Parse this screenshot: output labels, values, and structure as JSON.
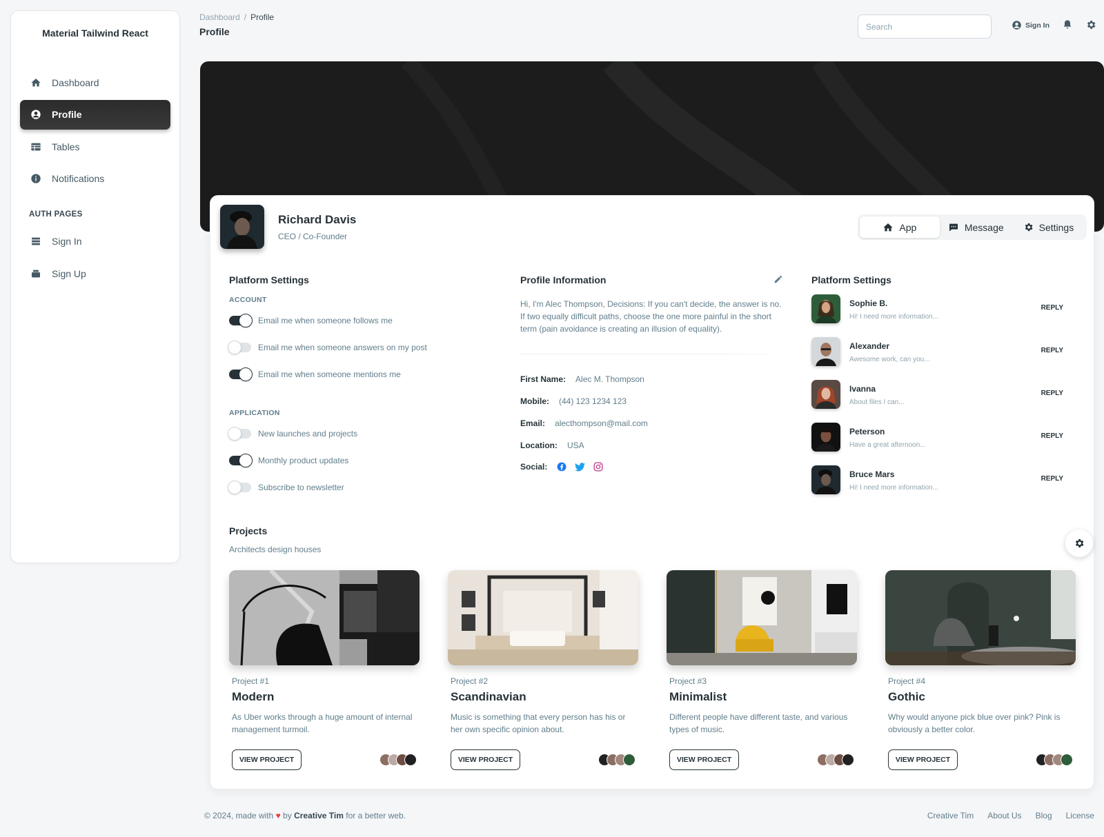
{
  "brand": "Material Tailwind React",
  "sidebar": {
    "items": [
      {
        "label": "Dashboard",
        "icon": "home-icon"
      },
      {
        "label": "Profile",
        "icon": "user-circle-icon",
        "active": true
      },
      {
        "label": "Tables",
        "icon": "table-icon"
      },
      {
        "label": "Notifications",
        "icon": "info-icon"
      }
    ],
    "auth_label": "AUTH PAGES",
    "auth_items": [
      {
        "label": "Sign In",
        "icon": "sign-in-icon"
      },
      {
        "label": "Sign Up",
        "icon": "sign-up-icon"
      }
    ]
  },
  "breadcrumb": {
    "root": "Dashboard",
    "sep": "/",
    "current": "Profile"
  },
  "page_title": "Profile",
  "search": {
    "placeholder": "Search"
  },
  "topbar": {
    "sign_in": "Sign In"
  },
  "profile": {
    "name": "Richard Davis",
    "role": "CEO / Co-Founder"
  },
  "tabs": [
    {
      "label": "App",
      "icon": "home-icon",
      "active": true
    },
    {
      "label": "Message",
      "icon": "chat-icon"
    },
    {
      "label": "Settings",
      "icon": "gear-icon"
    }
  ],
  "platform_settings": {
    "title": "Platform Settings",
    "account_label": "ACCOUNT",
    "account": [
      {
        "label": "Email me when someone follows me",
        "on": true
      },
      {
        "label": "Email me when someone answers on my post",
        "on": false
      },
      {
        "label": "Email me when someone mentions me",
        "on": true
      }
    ],
    "application_label": "APPLICATION",
    "application": [
      {
        "label": "New launches and projects",
        "on": false
      },
      {
        "label": "Monthly product updates",
        "on": true
      },
      {
        "label": "Subscribe to newsletter",
        "on": false
      }
    ]
  },
  "profile_info": {
    "title": "Profile Information",
    "description": "Hi, I'm Alec Thompson, Decisions: If you can't decide, the answer is no. If two equally difficult paths, choose the one more painful in the short term (pain avoidance is creating an illusion of equality).",
    "fields": [
      {
        "key": "First Name:",
        "value": "Alec M. Thompson"
      },
      {
        "key": "Mobile:",
        "value": "(44) 123 1234 123"
      },
      {
        "key": "Email:",
        "value": "alecthompson@mail.com"
      },
      {
        "key": "Location:",
        "value": "USA"
      }
    ],
    "social_label": "Social:",
    "social_colors": {
      "facebook": "#1877f2",
      "twitter": "#1da1f2",
      "instagram": "#c13584"
    }
  },
  "conversations": {
    "title": "Platform Settings",
    "reply_label": "REPLY",
    "items": [
      {
        "name": "Sophie B.",
        "message": "Hi! I need more information..."
      },
      {
        "name": "Alexander",
        "message": "Awesome work, can you..."
      },
      {
        "name": "Ivanna",
        "message": "About files I can..."
      },
      {
        "name": "Peterson",
        "message": "Have a great afternoon..."
      },
      {
        "name": "Bruce Mars",
        "message": "Hi! I need more information..."
      }
    ]
  },
  "projects": {
    "title": "Projects",
    "subtitle": "Architects design houses",
    "button_label": "VIEW PROJECT",
    "items": [
      {
        "tag": "Project #1",
        "title": "Modern",
        "description": "As Uber works through a huge amount of internal management turmoil."
      },
      {
        "tag": "Project #2",
        "title": "Scandinavian",
        "description": "Music is something that every person has his or her own specific opinion about."
      },
      {
        "tag": "Project #3",
        "title": "Minimalist",
        "description": "Different people have different taste, and various types of music."
      },
      {
        "tag": "Project #4",
        "title": "Gothic",
        "description": "Why would anyone pick blue over pink? Pink is obviously a better color."
      }
    ]
  },
  "footer": {
    "prefix": "© 2024, made with",
    "by": "by",
    "author": "Creative Tim",
    "suffix": "for a better web.",
    "links": [
      "Creative Tim",
      "About Us",
      "Blog",
      "License"
    ]
  }
}
